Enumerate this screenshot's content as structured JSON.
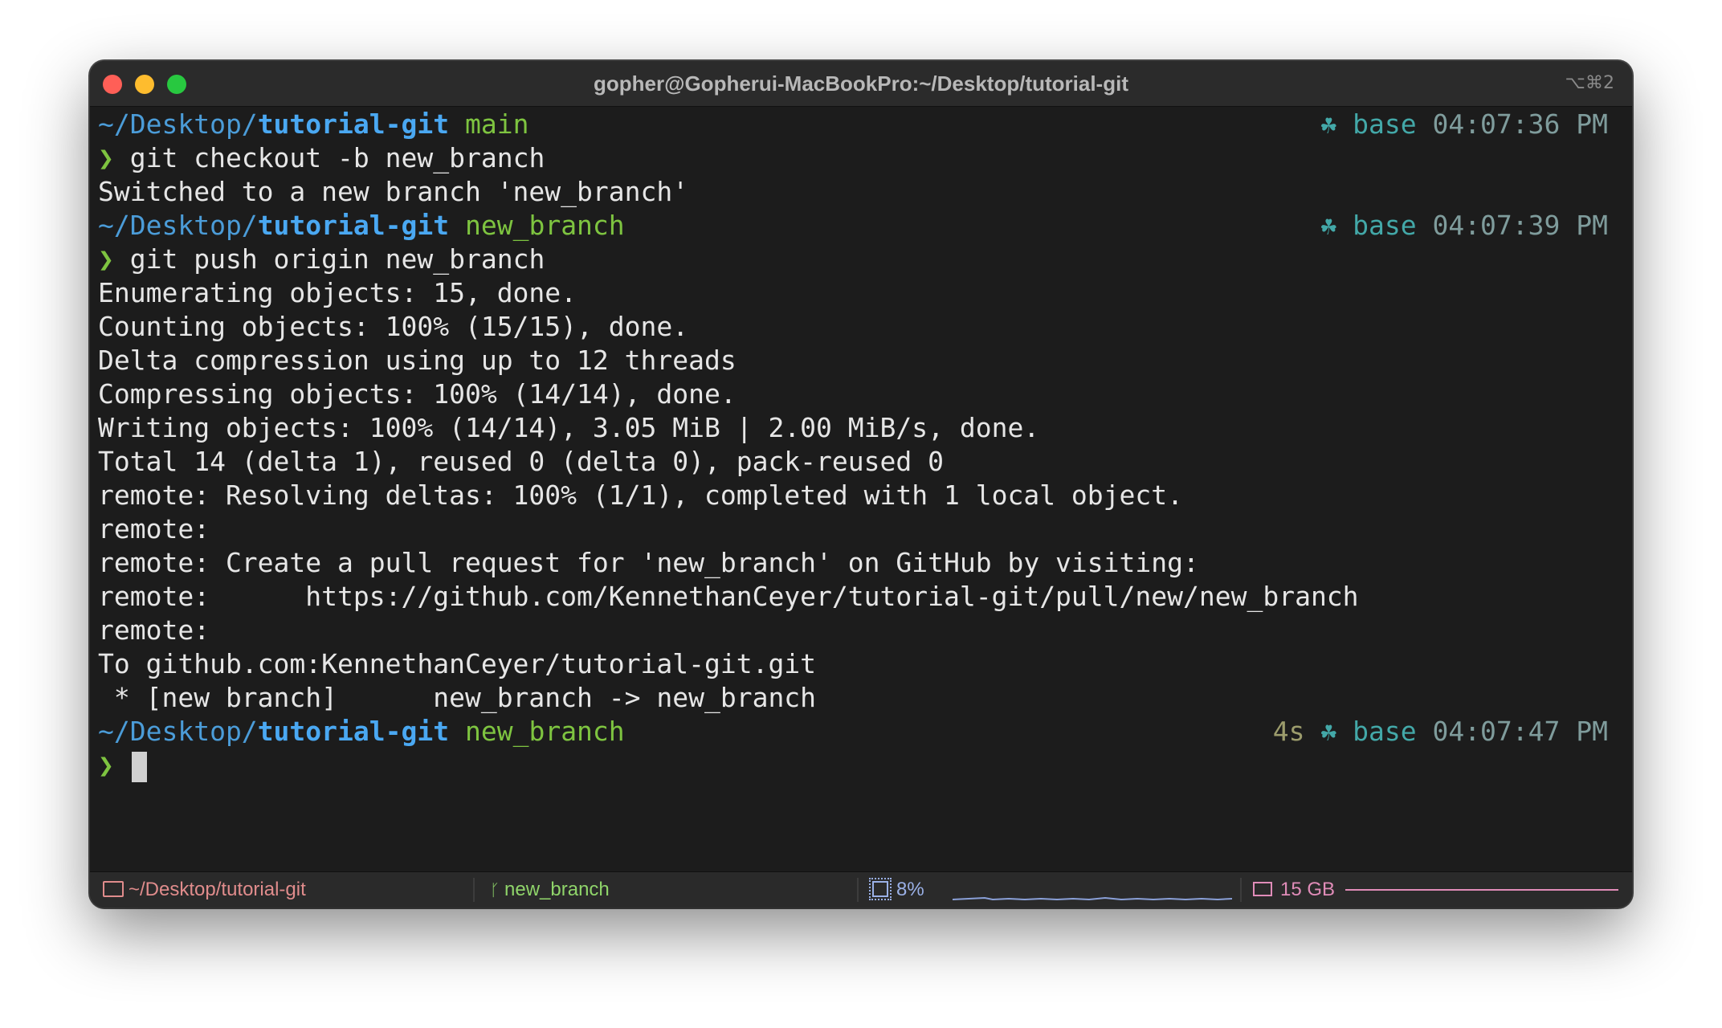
{
  "window": {
    "title": "gopher@Gopherui-MacBookPro:~/Desktop/tutorial-git",
    "shortcut": "⌥⌘2"
  },
  "terminal": {
    "prompt_char": "❯",
    "blocks": [
      {
        "path_prefix": "~/Desktop/",
        "repo": "tutorial-git",
        "branch": "main",
        "duration": "",
        "env_icon": "python-icon",
        "env": "base",
        "time": "04:07:36 PM",
        "command": "git checkout -b new_branch",
        "output": [
          "Switched to a new branch 'new_branch'"
        ]
      },
      {
        "path_prefix": "~/Desktop/",
        "repo": "tutorial-git",
        "branch": "new_branch",
        "duration": "",
        "env_icon": "python-icon",
        "env": "base",
        "time": "04:07:39 PM",
        "command": "git push origin new_branch",
        "output": [
          "Enumerating objects: 15, done.",
          "Counting objects: 100% (15/15), done.",
          "Delta compression using up to 12 threads",
          "Compressing objects: 100% (14/14), done.",
          "Writing objects: 100% (14/14), 3.05 MiB | 2.00 MiB/s, done.",
          "Total 14 (delta 1), reused 0 (delta 0), pack-reused 0",
          "remote: Resolving deltas: 100% (1/1), completed with 1 local object.",
          "remote:",
          "remote: Create a pull request for 'new_branch' on GitHub by visiting:",
          "remote:      https://github.com/KennethanCeyer/tutorial-git/pull/new/new_branch",
          "remote:",
          "To github.com:KennethanCeyer/tutorial-git.git",
          " * [new branch]      new_branch -> new_branch"
        ]
      },
      {
        "path_prefix": "~/Desktop/",
        "repo": "tutorial-git",
        "branch": "new_branch",
        "duration": "4s",
        "env_icon": "python-icon",
        "env": "base",
        "time": "04:07:47 PM",
        "command": "",
        "output": []
      }
    ]
  },
  "statusbar": {
    "path": "~/Desktop/tutorial-git",
    "branch": "new_branch",
    "cpu": "8%",
    "memory": "15 GB"
  },
  "colors": {
    "accent_path": "#4aa8f2",
    "accent_branch": "#7ec440",
    "env": "#43a8a8"
  }
}
